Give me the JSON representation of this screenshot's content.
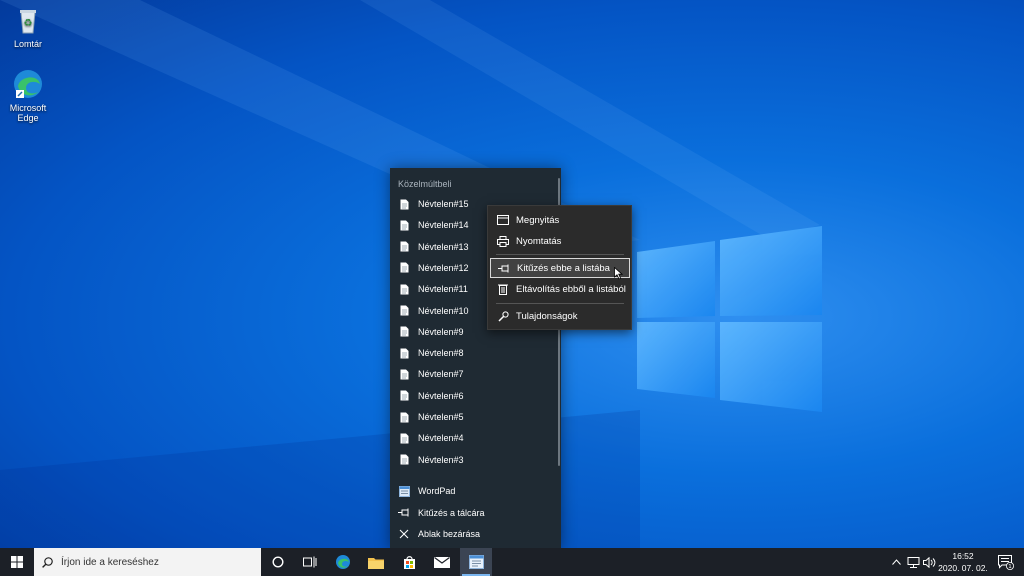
{
  "desktop": {
    "icons": [
      {
        "label": "Lomtár",
        "icon": "recycle-bin-icon"
      },
      {
        "label": "Microsoft Edge",
        "icon": "edge-icon"
      }
    ]
  },
  "jumplist": {
    "heading": "Közelmúltbeli",
    "recent": [
      "Névtelen#15",
      "Névtelen#14",
      "Névtelen#13",
      "Névtelen#12",
      "Névtelen#11",
      "Névtelen#10",
      "Névtelen#9",
      "Névtelen#8",
      "Névtelen#7",
      "Névtelen#6",
      "Névtelen#5",
      "Névtelen#4",
      "Névtelen#3"
    ],
    "tasks": [
      {
        "label": "WordPad",
        "icon": "wordpad-icon"
      },
      {
        "label": "Kitűzés a tálcára",
        "icon": "pin-icon"
      },
      {
        "label": "Ablak bezárása",
        "icon": "close-icon"
      }
    ]
  },
  "context_menu": {
    "items": [
      {
        "label": "Megnyitás",
        "icon": "window-icon"
      },
      {
        "label": "Nyomtatás",
        "icon": "printer-icon"
      },
      {
        "label": "Kitűzés ebbe a listába",
        "icon": "pin-icon",
        "highlighted": true
      },
      {
        "label": "Eltávolítás ebből a listából",
        "icon": "trash-icon"
      },
      {
        "label": "Tulajdonságok",
        "icon": "wrench-icon"
      }
    ]
  },
  "taskbar": {
    "search_placeholder": "Írjon ide a kereséshez",
    "clock_time": "16:52",
    "clock_date": "2020. 07. 02.",
    "notification_count": "1"
  },
  "colors": {
    "accent": "#7ab6f0",
    "taskbar": "#1c2027",
    "jumplist": "#1f2a33",
    "menu": "#2b2b2b"
  }
}
